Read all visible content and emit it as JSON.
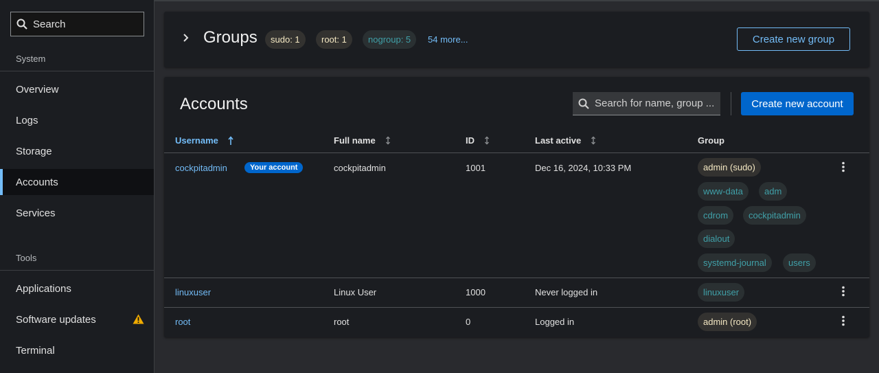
{
  "sidebar": {
    "search_placeholder": "Search",
    "sections": {
      "system": "System",
      "tools": "Tools"
    },
    "items": [
      {
        "label": "Overview"
      },
      {
        "label": "Logs"
      },
      {
        "label": "Storage"
      },
      {
        "label": "Accounts",
        "active": true
      },
      {
        "label": "Services"
      },
      {
        "label": "Applications"
      },
      {
        "label": "Software updates",
        "icon": "warning-icon"
      },
      {
        "label": "Terminal"
      }
    ]
  },
  "groups": {
    "title": "Groups",
    "chips": [
      {
        "label": "sudo: 1"
      },
      {
        "label": "root: 1"
      },
      {
        "label": "nogroup: 5"
      }
    ],
    "more": "54 more...",
    "create_button": "Create new group"
  },
  "accounts": {
    "title": "Accounts",
    "search_placeholder": "Search for name, group ...",
    "create_button": "Create new account",
    "columns": [
      "Username",
      "Full name",
      "ID",
      "Last active",
      "Group"
    ],
    "rows": [
      {
        "username": "cockpitadmin",
        "badge": "Your account",
        "full_name": "cockpitadmin",
        "id": "1001",
        "last_active": "Dec 16, 2024, 10:33 PM",
        "groups": [
          "admin (sudo)",
          "www-data",
          "adm",
          "cdrom",
          "cockpitadmin",
          "dialout",
          "systemd-journal",
          "users"
        ]
      },
      {
        "username": "linuxuser",
        "full_name": "Linux User",
        "id": "1000",
        "last_active": "Never logged in",
        "groups": [
          "linuxuser"
        ]
      },
      {
        "username": "root",
        "full_name": "root",
        "id": "0",
        "last_active": "Logged in",
        "groups": [
          "admin (root)"
        ]
      }
    ]
  },
  "colors": {
    "accent": "#73bcf7",
    "primary": "#0066cc",
    "warning": "#f0ab00",
    "chip_gold_text": "#f4e8c3",
    "chip_teal_text": "#40a0a8"
  }
}
